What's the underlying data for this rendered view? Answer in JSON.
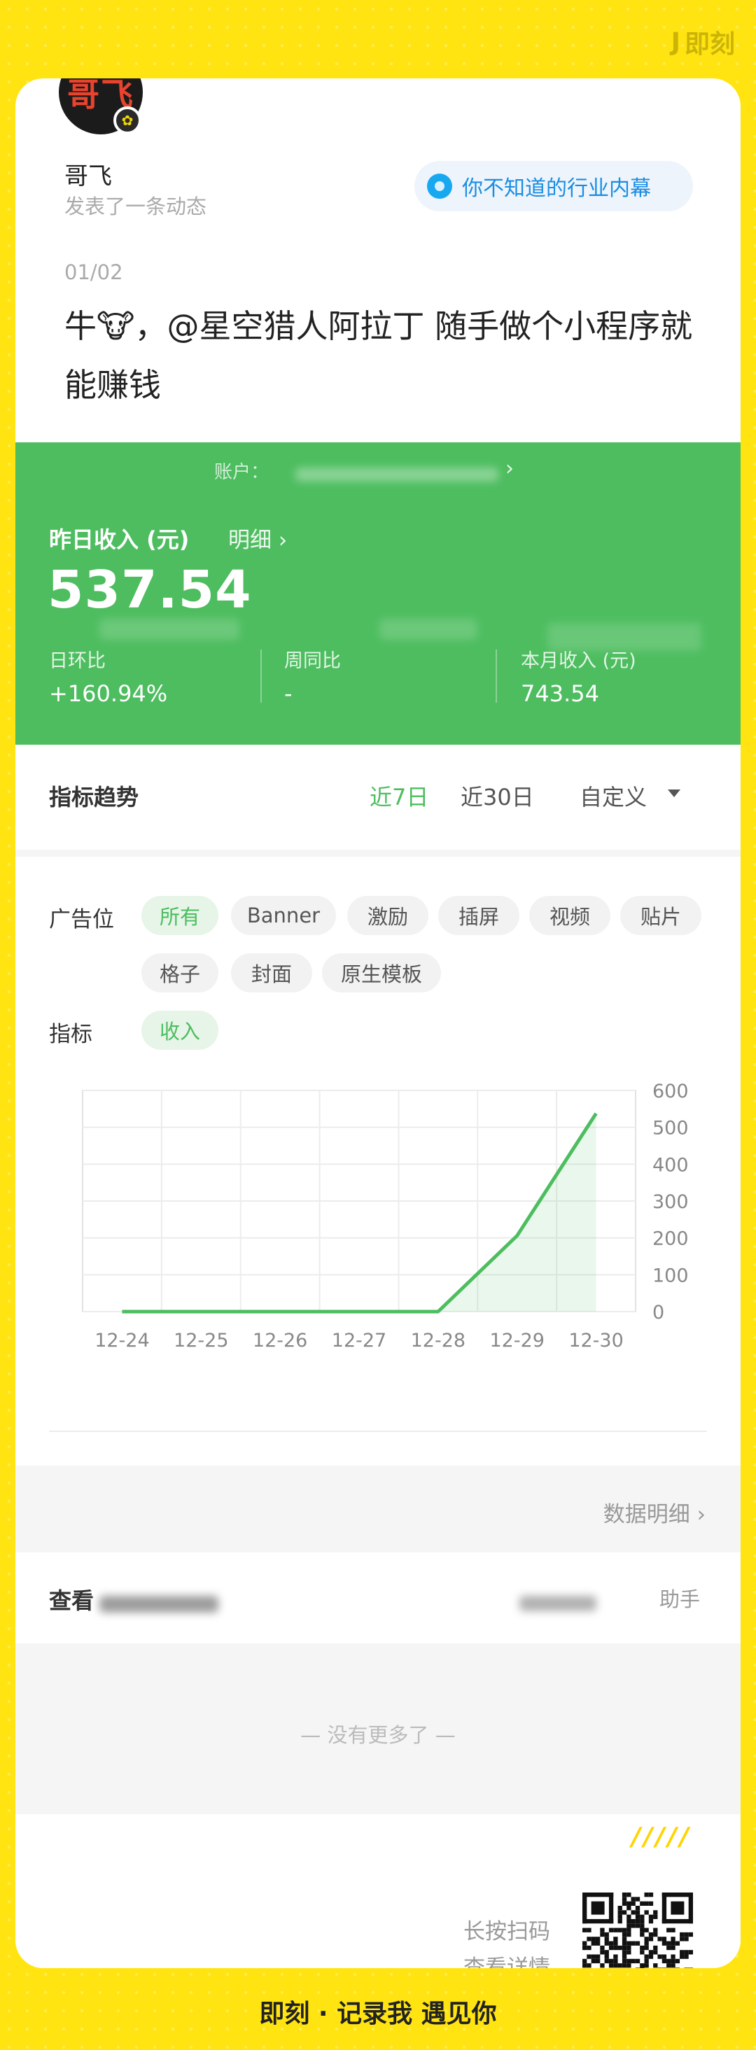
{
  "brand": {
    "top_logo": "即刻",
    "bottom_slogan": "即刻 · 记录我 遇见你"
  },
  "post": {
    "avatar_text": "哥飞",
    "author": "哥飞",
    "action": "发表了一条动态",
    "topic": "你不知道的行业内幕",
    "date": "01/02",
    "text": "牛🐮，@星空猎人阿拉丁 随手做个小程序就能赚钱"
  },
  "screenshot": {
    "account_label": "账户：",
    "yesterday_label": "昨日收入 (元)",
    "detail_link": "明细 ›",
    "yesterday_value": "537.54",
    "metrics": [
      {
        "label": "日环比",
        "value": "+160.94%"
      },
      {
        "label": "周同比",
        "value": "-"
      },
      {
        "label": "本月收入 (元)",
        "value": "743.54"
      }
    ],
    "trend_title": "指标趋势",
    "trend_tabs": [
      "近7日",
      "近30日",
      "自定义"
    ],
    "ad_slot_label": "广告位",
    "ad_slot_chips": [
      "所有",
      "Banner",
      "激励",
      "插屏",
      "视频",
      "贴片",
      "格子",
      "封面",
      "原生模板"
    ],
    "metric_label": "指标",
    "metric_chip": "收入",
    "data_detail": "数据明细 ›",
    "look_label": "查看",
    "look_right": "助手",
    "no_more": "— 没有更多了 —"
  },
  "chart_data": {
    "type": "line",
    "categories": [
      "12-24",
      "12-25",
      "12-26",
      "12-27",
      "12-28",
      "12-29",
      "12-30"
    ],
    "values": [
      0,
      0,
      0,
      0,
      0,
      206,
      537.54
    ],
    "ylim": [
      0,
      600
    ],
    "yticks": [
      0,
      100,
      200,
      300,
      400,
      500,
      600
    ],
    "y_axis_side": "right",
    "grid": true,
    "color": "#4DBD5F"
  },
  "footer": {
    "slashes": "/////",
    "scan_line1": "长按扫码",
    "scan_line2": "查看详情"
  },
  "colors": {
    "background": "#FFE411",
    "green": "#4DBD5F",
    "topic_blue": "#1a8de2"
  }
}
